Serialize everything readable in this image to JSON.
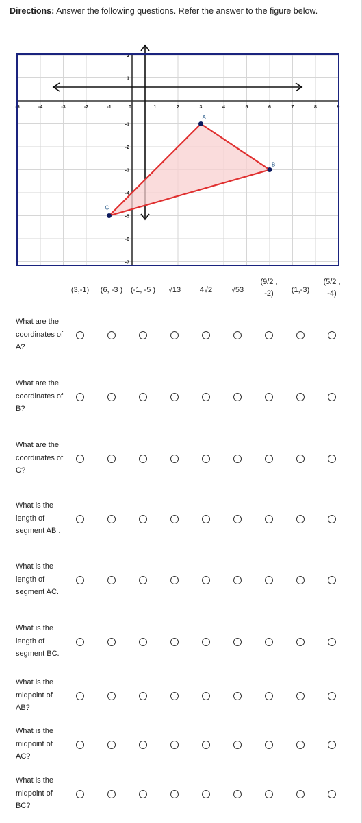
{
  "directions": {
    "bold": "Directions:",
    "text": " Answer the following questions. Refer the answer to the figure below."
  },
  "figure": {
    "x_ticks": [
      "-5",
      "-4",
      "-3",
      "-2",
      "-1",
      "0",
      "1",
      "2",
      "3",
      "4",
      "5",
      "6",
      "7",
      "8",
      "9"
    ],
    "y_ticks": [
      "2",
      "1",
      "-1",
      "-2",
      "-3",
      "-4",
      "-5",
      "-6",
      "-7"
    ],
    "points": [
      {
        "label": "A",
        "x": 3,
        "y": -1
      },
      {
        "label": "B",
        "x": 6,
        "y": -3
      },
      {
        "label": "C",
        "x": -1,
        "y": -5
      }
    ],
    "triangle_color": "#e03030",
    "fill_color": "#f8d0d0",
    "point_color": "#0d1b5e",
    "frame_color": "#1a237e"
  },
  "columns": [
    "(3,-1)",
    "(6, -3 )",
    "(-1, -5 )",
    "√13",
    "4√2",
    "√53",
    "(9/2 , -2)",
    "(1,-3)",
    "(5/2 , -4)"
  ],
  "questions": [
    {
      "label": "What are the coordinates of A?"
    },
    {
      "label": "What are the coordinates of B?"
    },
    {
      "label": "What are the coordinates of C?"
    },
    {
      "label": "What is the length of segment AB ."
    },
    {
      "label": "What is the length of segment AC."
    },
    {
      "label": "What is the length of segment BC."
    },
    {
      "label": "What is the midpoint of AB?"
    },
    {
      "label": "What is the midpoint of AC?"
    },
    {
      "label": "What is the midpoint of BC?"
    }
  ]
}
